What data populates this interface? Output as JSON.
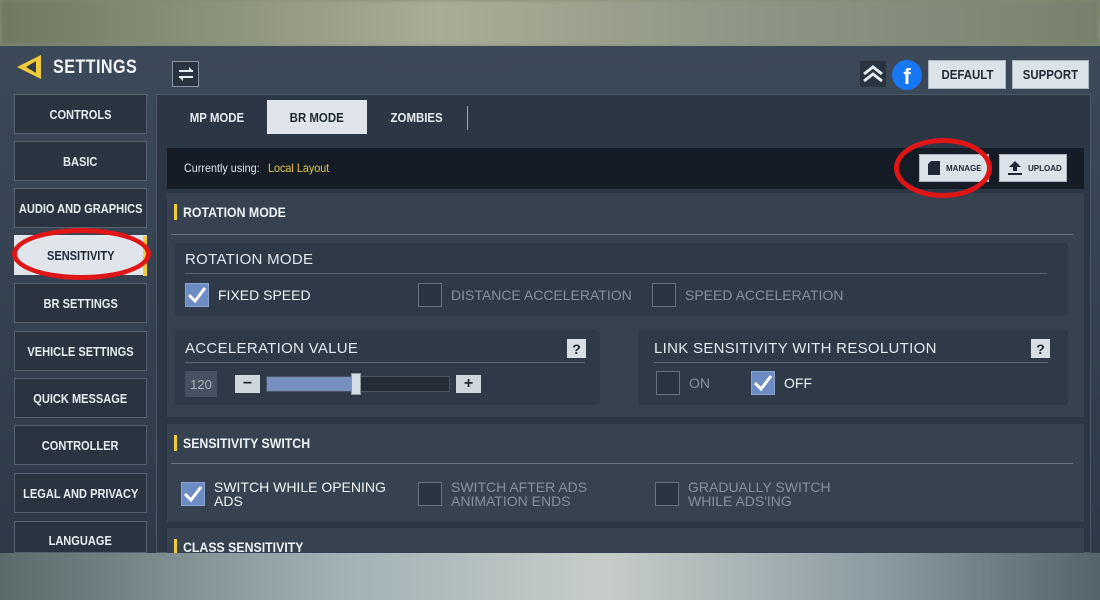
{
  "header": {
    "title": "SETTINGS",
    "back_icon": "back-arrow-icon",
    "default_label": "DEFAULT",
    "support_label": "SUPPORT"
  },
  "sidebar": {
    "items": [
      {
        "label": "CONTROLS"
      },
      {
        "label": "BASIC"
      },
      {
        "label": "AUDIO AND GRAPHICS"
      },
      {
        "label": "SENSITIVITY"
      },
      {
        "label": "BR SETTINGS"
      },
      {
        "label": "VEHICLE SETTINGS"
      },
      {
        "label": "QUICK MESSAGE"
      },
      {
        "label": "CONTROLLER"
      },
      {
        "label": "LEGAL AND PRIVACY"
      },
      {
        "label": "LANGUAGE"
      }
    ],
    "active": "SENSITIVITY"
  },
  "tabs": [
    {
      "label": "MP MODE"
    },
    {
      "label": "BR MODE"
    },
    {
      "label": "ZOMBIES"
    }
  ],
  "active_tab": "BR MODE",
  "layout_bar": {
    "prefix": "Currently using: ",
    "value": "Local Layout",
    "manage_label": "MANAGE",
    "upload_label": "UPLOAD"
  },
  "rotation_section": {
    "header": "ROTATION MODE",
    "card_title": "ROTATION MODE",
    "options": [
      {
        "label": "FIXED SPEED",
        "checked": true
      },
      {
        "label": "DISTANCE ACCELERATION",
        "checked": false
      },
      {
        "label": "SPEED ACCELERATION",
        "checked": false
      }
    ],
    "acceleration": {
      "title": "ACCELERATION VALUE",
      "value": "120",
      "slider_fraction": 0.49,
      "help": "?"
    },
    "link": {
      "title": "LINK SENSITIVITY WITH RESOLUTION",
      "help": "?",
      "on_label": "ON",
      "off_label": "OFF",
      "selected": "OFF"
    }
  },
  "switch_section": {
    "header": "SENSITIVITY SWITCH",
    "options": [
      {
        "line1": "SWITCH WHILE OPENING",
        "line2": "ADS",
        "checked": true
      },
      {
        "line1": "SWITCH AFTER ADS",
        "line2": "ANIMATION ENDS",
        "checked": false
      },
      {
        "line1": "GRADUALLY SWITCH",
        "line2": "WHILE ADS'ING",
        "checked": false
      }
    ]
  },
  "next_section": {
    "header": "CLASS SENSITIVITY"
  },
  "colors": {
    "accent": "#f0cc3a",
    "checked": "#6d8cc3",
    "highlight_ring": "#e01616"
  }
}
